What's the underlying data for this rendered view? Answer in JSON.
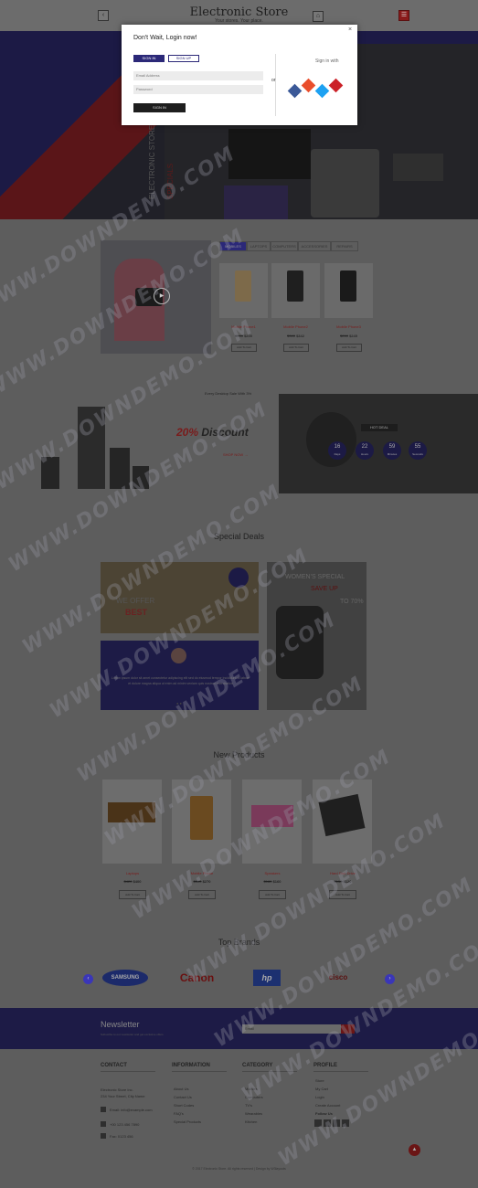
{
  "header": {
    "logo": "Electronic Store",
    "tagline": "Your stores. Your place.",
    "prev_icon": "‹",
    "cart_icon": "⌂",
    "account_icon": "☰"
  },
  "hero": {
    "vertical_text": "ELECTRONIC STORE",
    "vertical_text_2": "SPECIALS"
  },
  "modal": {
    "title": "Don't Wait, Login now!",
    "close": "×",
    "tab_signin": "SIGN IN",
    "tab_signup": "SIGN UP",
    "email_placeholder": "Email Address",
    "password_placeholder": "Password",
    "submit": "SIGN IN",
    "or": "or",
    "signin_with": "Sign in with",
    "socials": [
      {
        "icon": "facebook-icon",
        "glyph": "f",
        "color": "#3b5998"
      },
      {
        "icon": "twitter-icon",
        "glyph": "t",
        "color": "#e94e2c"
      },
      {
        "icon": "google-icon",
        "glyph": "g",
        "color": "#1da1f2"
      },
      {
        "icon": "pinterest-icon",
        "glyph": "p",
        "color": "#cb2027"
      }
    ]
  },
  "products": {
    "tabs": [
      "MOBILES",
      "LAPTOPS",
      "COMPUTERS",
      "ACCESSORIES",
      "REPAIRS"
    ],
    "items": [
      {
        "name": "Mobile Phone1",
        "old": "$260",
        "price": "$200",
        "btn": "Add To Cart"
      },
      {
        "name": "Mobile Phone2",
        "old": "$380",
        "price": "$342",
        "btn": "Add To Cart"
      },
      {
        "name": "Mobile Phone3",
        "old": "$260",
        "price": "$245",
        "btn": "Add To Cart"
      }
    ]
  },
  "offer": {
    "small": "Every Desktop Sale With 3%",
    "pct": "20%",
    "word": "Discount",
    "link": "SHOP NOW →",
    "deal_label": "HOT DEAL",
    "timer": [
      {
        "n": "16",
        "u": "Days"
      },
      {
        "n": "22",
        "u": "Hours"
      },
      {
        "n": "59",
        "u": "Minutes"
      },
      {
        "n": "55",
        "u": "Seconds"
      }
    ]
  },
  "special_deals": {
    "title": "Special Deals",
    "deal1_l1": "WE OFFER",
    "deal1_l2": "BEST",
    "testimonial": "Lorem ipsum dolor sit amet consectetur adipiscing elit sed do eiusmod tempor incididunt ut labore et dolore magna aliqua ut enim ad minim veniam quis nostrud exercitation",
    "dots": "● ●",
    "women_l1": "WOMEN'S SPECIAL",
    "women_l2": "SAVE UP",
    "women_l3": "TO 70%"
  },
  "new_products": {
    "title": "New Products",
    "items": [
      {
        "name": "Laptops",
        "old": "$420",
        "price": "$400",
        "btn": "Add To Cart"
      },
      {
        "name": "Mobile Phone",
        "old": "$300",
        "price": "$270",
        "btn": "Add To Cart"
      },
      {
        "name": "Speakers",
        "old": "$180",
        "price": "$160",
        "btn": "Add To Cart"
      },
      {
        "name": "Hard Disk Drive",
        "old": "$150",
        "price": "$120",
        "btn": "Add To Cart"
      }
    ]
  },
  "brands": {
    "title": "Top Brands",
    "items": [
      "SAMSUNG",
      "Canon",
      "hp",
      "cisco"
    ],
    "prev": "‹",
    "next": "›"
  },
  "newsletter": {
    "title": "Newsletter",
    "subtitle": "Subscribe to our newsletter and get exclusive offers",
    "placeholder": "Email"
  },
  "footer": {
    "contact_title": "CONTACT",
    "contact": [
      "Electronic Store Inc.",
      "234 Your Street, City Name",
      "Email: info@example.com",
      "+00 123 456 7890",
      "Fax: 0123 456"
    ],
    "info_title": "INFORMATION",
    "info": [
      "About Us",
      "Contact Us",
      "Short Codes",
      "FAQ's",
      "Special Products"
    ],
    "cat_title": "CATEGORY",
    "cats": [
      "Mobiles",
      "Computers",
      "TV's",
      "Wearables",
      "Kitchen"
    ],
    "profile_title": "PROFILE",
    "profile": [
      "Store",
      "My Cart",
      "Login",
      "Create Account"
    ],
    "follow": "Follow Us",
    "copyright": "© 2017 Electronic Store. All rights reserved | Design by W3layouts"
  },
  "watermark": "WWW.DOWNDEMO.COM"
}
